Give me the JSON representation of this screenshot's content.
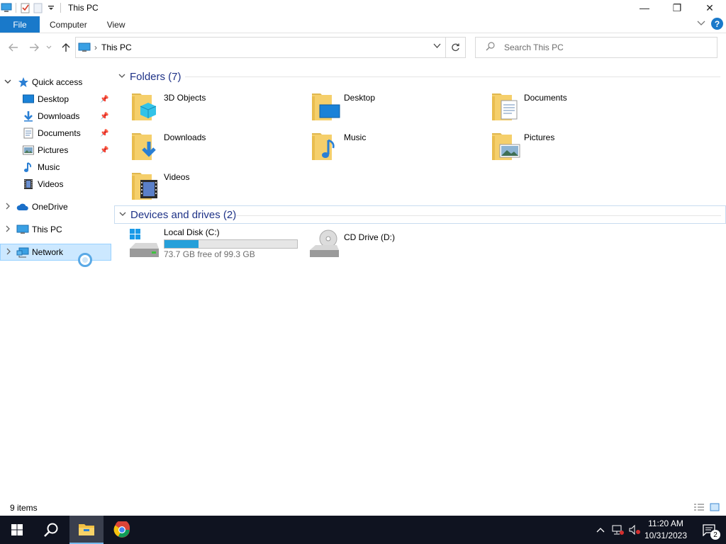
{
  "window": {
    "title": "This PC",
    "controls": {
      "minimize": "—",
      "maximize": "❐",
      "close": "✕"
    }
  },
  "ribbon": {
    "tabs": [
      {
        "label": "File"
      },
      {
        "label": "Computer"
      },
      {
        "label": "View"
      }
    ]
  },
  "address": {
    "breadcrumb": "This PC",
    "search_placeholder": "Search This PC"
  },
  "nav": {
    "quick_access": "Quick access",
    "quick_items": [
      {
        "label": "Desktop",
        "pinned": true,
        "icon": "desktop-icon"
      },
      {
        "label": "Downloads",
        "pinned": true,
        "icon": "downloads-icon"
      },
      {
        "label": "Documents",
        "pinned": true,
        "icon": "documents-icon"
      },
      {
        "label": "Pictures",
        "pinned": true,
        "icon": "pictures-icon"
      },
      {
        "label": "Music",
        "pinned": false,
        "icon": "music-icon"
      },
      {
        "label": "Videos",
        "pinned": false,
        "icon": "videos-icon"
      }
    ],
    "onedrive": "OneDrive",
    "this_pc": "This PC",
    "network": "Network"
  },
  "content": {
    "folders_header": "Folders (7)",
    "folders": [
      {
        "label": "3D Objects",
        "icon": "3d-objects-folder-icon"
      },
      {
        "label": "Desktop",
        "icon": "desktop-folder-icon"
      },
      {
        "label": "Documents",
        "icon": "documents-folder-icon"
      },
      {
        "label": "Downloads",
        "icon": "downloads-folder-icon"
      },
      {
        "label": "Music",
        "icon": "music-folder-icon"
      },
      {
        "label": "Pictures",
        "icon": "pictures-folder-icon"
      },
      {
        "label": "Videos",
        "icon": "videos-folder-icon"
      }
    ],
    "drives_header": "Devices and drives (2)",
    "drives": [
      {
        "label": "Local Disk (C:)",
        "free_text": "73.7 GB free of 99.3 GB",
        "used_fraction": 0.258
      },
      {
        "label": "CD Drive (D:)"
      }
    ]
  },
  "status": {
    "item_count": "9 items"
  },
  "taskbar": {
    "time": "11:20 AM",
    "date": "10/31/2023",
    "notification_count": "2"
  },
  "colors": {
    "accent": "#1979ca",
    "selection": "#cce8ff",
    "taskbar": "#0f1320"
  }
}
